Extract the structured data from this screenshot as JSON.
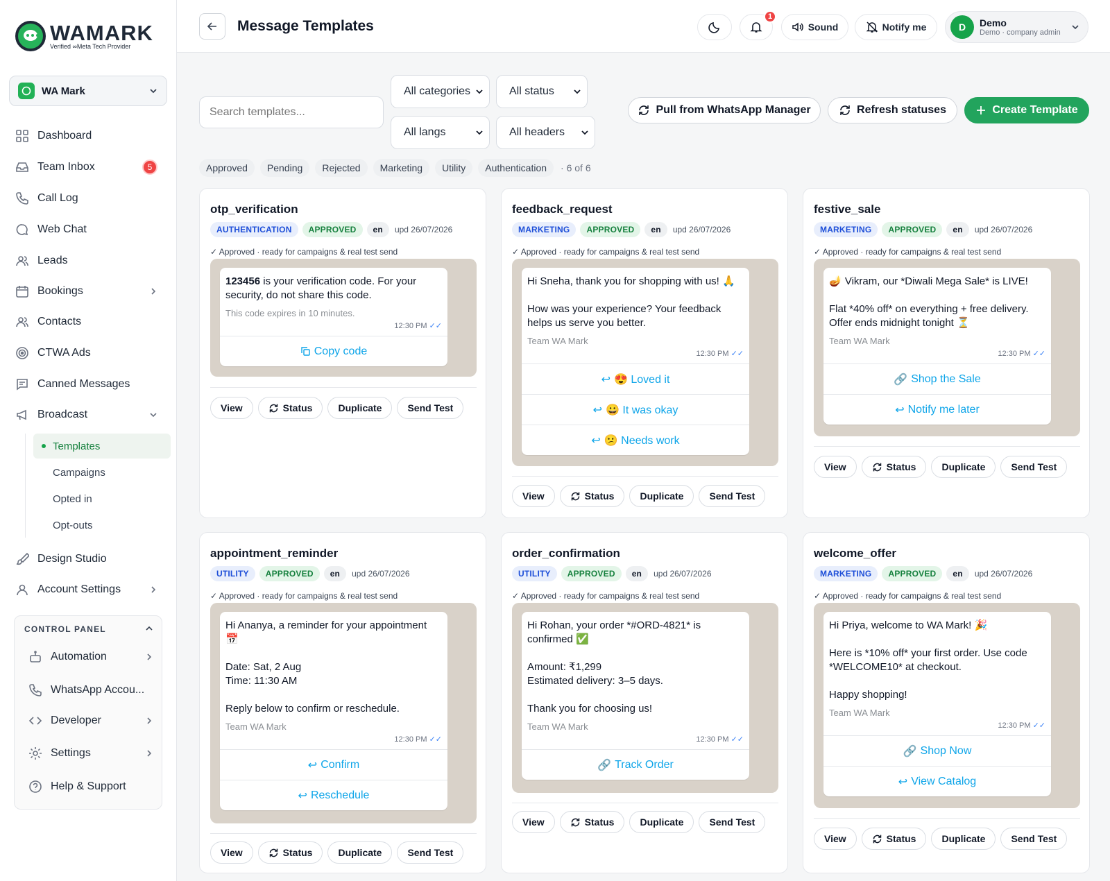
{
  "brand": {
    "name": "WAMARK",
    "tagline": "Verified ∞Meta Tech Provider"
  },
  "workspace": {
    "name": "WA Mark"
  },
  "sidebar": {
    "items": [
      {
        "label": "Dashboard"
      },
      {
        "label": "Team Inbox",
        "badge": "5"
      },
      {
        "label": "Call Log"
      },
      {
        "label": "Web Chat"
      },
      {
        "label": "Leads"
      },
      {
        "label": "Bookings"
      },
      {
        "label": "Contacts"
      },
      {
        "label": "CTWA Ads"
      },
      {
        "label": "Canned Messages"
      },
      {
        "label": "Broadcast"
      },
      {
        "label": "Design Studio"
      },
      {
        "label": "Account Settings"
      }
    ],
    "broadcast_sub": [
      "Templates",
      "Campaigns",
      "Opted in",
      "Opt-outs"
    ],
    "control_panel": {
      "title": "CONTROL PANEL",
      "items": [
        "Automation",
        "WhatsApp Accou...",
        "Developer",
        "Settings",
        "Help & Support"
      ]
    }
  },
  "header": {
    "title": "Message Templates",
    "notif_count": "1",
    "sound_label": "Sound",
    "notify_label": "Notify me",
    "user": {
      "initial": "D",
      "name": "Demo",
      "role": "Demo · company admin"
    }
  },
  "filters": {
    "search_placeholder": "Search templates...",
    "category": "All categories",
    "status": "All status",
    "langs": "All langs",
    "headers": "All headers",
    "pull_label": "Pull from WhatsApp Manager",
    "refresh_label": "Refresh statuses",
    "create_label": "Create Template",
    "chips": [
      "Approved",
      "Pending",
      "Rejected",
      "Marketing",
      "Utility",
      "Authentication"
    ],
    "count": "· 6 of 6"
  },
  "colors": {
    "accent": "#22a45d",
    "chat_bg": "#d9d2c9",
    "link": "#0ea5e9"
  },
  "actions": {
    "view": "View",
    "status": "Status",
    "duplicate": "Duplicate",
    "send_test": "Send Test"
  },
  "templates": [
    {
      "name": "otp_verification",
      "category": "AUTHENTICATION",
      "status": "APPROVED",
      "lang": "en",
      "updated": "upd 26/07/2026",
      "note": "✓ Approved · ready for campaigns & real test send",
      "code": "123456",
      "message": " is your verification code. For your security, do not share this code.",
      "footer": "This code expires in 10 minutes.",
      "time": "12:30 PM",
      "buttons": [
        "Copy code"
      ]
    },
    {
      "name": "feedback_request",
      "category": "MARKETING",
      "status": "APPROVED",
      "lang": "en",
      "updated": "upd 26/07/2026",
      "note": "✓ Approved · ready for campaigns & real test send",
      "message": "Hi Sneha, thank you for shopping with us! 🙏\n\nHow was your experience? Your feedback helps us serve you better.",
      "footer": "Team WA Mark",
      "time": "12:30 PM",
      "buttons": [
        "😍 Loved it",
        "😀 It was okay",
        "😕 Needs work"
      ]
    },
    {
      "name": "festive_sale",
      "category": "MARKETING",
      "status": "APPROVED",
      "lang": "en",
      "updated": "upd 26/07/2026",
      "note": "✓ Approved · ready for campaigns & real test send",
      "message": "🪔 Vikram, our *Diwali Mega Sale* is LIVE!\n\nFlat *40% off* on everything + free delivery. Offer ends midnight tonight ⏳",
      "footer": "Team WA Mark",
      "time": "12:30 PM",
      "buttons": [
        "Shop the Sale",
        "Notify me later"
      ]
    },
    {
      "name": "appointment_reminder",
      "category": "UTILITY",
      "status": "APPROVED",
      "lang": "en",
      "updated": "upd 26/07/2026",
      "note": "✓ Approved · ready for campaigns & real test send",
      "message": "Hi Ananya, a reminder for your appointment 📅\n\nDate: Sat, 2 Aug\nTime: 11:30 AM\n\nReply below to confirm or reschedule.",
      "footer": "Team WA Mark",
      "time": "12:30 PM",
      "buttons": [
        "Confirm",
        "Reschedule"
      ]
    },
    {
      "name": "order_confirmation",
      "category": "UTILITY",
      "status": "APPROVED",
      "lang": "en",
      "updated": "upd 26/07/2026",
      "note": "✓ Approved · ready for campaigns & real test send",
      "message": "Hi Rohan, your order *#ORD-4821* is confirmed ✅\n\nAmount: ₹1,299\nEstimated delivery: 3–5 days.\n\nThank you for choosing us!",
      "footer": "Team WA Mark",
      "time": "12:30 PM",
      "buttons": [
        "Track Order"
      ]
    },
    {
      "name": "welcome_offer",
      "category": "MARKETING",
      "status": "APPROVED",
      "lang": "en",
      "updated": "upd 26/07/2026",
      "note": "✓ Approved · ready for campaigns & real test send",
      "message": "Hi Priya, welcome to WA Mark! 🎉\n\nHere is *10% off* your first order. Use code *WELCOME10* at checkout.\n\nHappy shopping!",
      "footer": "Team WA Mark",
      "time": "12:30 PM",
      "buttons": [
        "Shop Now",
        "View Catalog"
      ]
    }
  ]
}
